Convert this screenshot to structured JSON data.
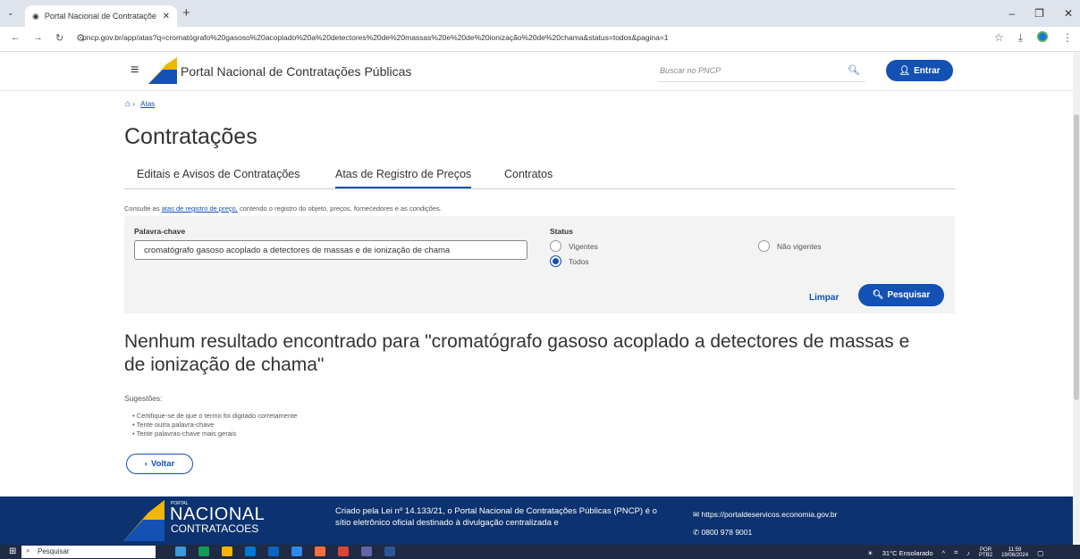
{
  "browser": {
    "tab_title": "Portal Nacional de Contrataçõe",
    "url": "pncp.gov.br/app/atas?q=cromatógrafo%20gasoso%20acoplado%20a%20detectores%20de%20massas%20e%20de%20ionização%20de%20chama&status=todos&pagina=1"
  },
  "header": {
    "brand": "Portal Nacional de Contratações Públicas",
    "search_placeholder": "Buscar no PNCP",
    "login_label": "Entrar"
  },
  "breadcrumb": {
    "current": "Atas"
  },
  "page": {
    "title": "Contratações",
    "tabs": [
      {
        "label": "Editais e Avisos de Contratações",
        "active": false
      },
      {
        "label": "Atas de Registro de Preços",
        "active": true
      },
      {
        "label": "Contratos",
        "active": false
      }
    ],
    "hint_prefix": "Consulte as ",
    "hint_link": "atas de registro de preço,",
    "hint_suffix": " contendo o registro do objeto, preços, fornecedores e as condições."
  },
  "filters": {
    "keyword_label": "Palavra-chave",
    "keyword_value": "cromatógrafo gasoso acoplado a detectores de massas e de ionização de chama",
    "status_label": "Status",
    "status_options": [
      {
        "label": "Vigentes",
        "selected": false
      },
      {
        "label": "Não vigentes",
        "selected": false
      },
      {
        "label": "Todos",
        "selected": true
      }
    ],
    "clear_label": "Limpar",
    "search_label": "Pesquisar"
  },
  "results": {
    "no_result_text": "Nenhum resultado encontrado para \"cromatógrafo gasoso acoplado a detectores de massas e de ionização de chama\"",
    "suggestions_title": "Sugestões:",
    "suggestions": [
      "Certifique-se de que o termo foi digitado corretamente",
      "Tente outra palavra-chave",
      "Tente palavras-chave mais gerais"
    ],
    "back_label": "Voltar"
  },
  "footer": {
    "logo_small": "PORTAL",
    "logo_big": "NACIONAL",
    "logo_sub": "CONTRATACOES",
    "text": "Criado pela Lei nº 14.133/21, o Portal Nacional de Contratações Públicas (PNCP) é o sítio eletrônico oficial destinado à divulgação centralizada e",
    "site": "https://portaldeservicos.economia.gov.br",
    "phone": "0800 978 9001"
  },
  "taskbar": {
    "search_placeholder": "Pesquisar",
    "weather": "31°C Ensolarado",
    "lang": "POR",
    "lang_sub": "PTB2",
    "time": "11:59",
    "date": "19/06/2024"
  },
  "colors": {
    "primary": "#1351b4",
    "footer": "#0c326f"
  }
}
